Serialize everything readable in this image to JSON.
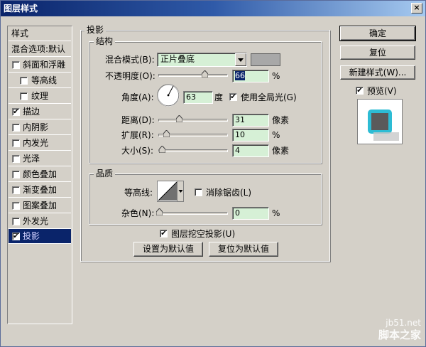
{
  "window": {
    "title": "图层样式",
    "close_glyph": "×"
  },
  "style_list": {
    "header": "样式",
    "blend_row": "混合选项:默认",
    "items": [
      {
        "label": "斜面和浮雕",
        "checked": false,
        "check_glyph": ""
      },
      {
        "label": "等高线",
        "checked": false,
        "check_glyph": ""
      },
      {
        "label": "纹理",
        "checked": false,
        "check_glyph": ""
      },
      {
        "label": "描边",
        "checked": true,
        "check_glyph": "✔"
      },
      {
        "label": "内阴影",
        "checked": false,
        "check_glyph": ""
      },
      {
        "label": "内发光",
        "checked": false,
        "check_glyph": ""
      },
      {
        "label": "光泽",
        "checked": false,
        "check_glyph": ""
      },
      {
        "label": "颜色叠加",
        "checked": false,
        "check_glyph": ""
      },
      {
        "label": "渐变叠加",
        "checked": false,
        "check_glyph": ""
      },
      {
        "label": "图案叠加",
        "checked": false,
        "check_glyph": ""
      },
      {
        "label": "外发光",
        "checked": false,
        "check_glyph": ""
      },
      {
        "label": "投影",
        "checked": true,
        "check_glyph": "✔"
      }
    ]
  },
  "drop_shadow": {
    "title": "投影",
    "structure": {
      "title": "结构",
      "blend_mode_label": "混合模式(B):",
      "blend_mode_value": "正片叠底",
      "opacity_label": "不透明度(O):",
      "opacity_value": "66",
      "opacity_unit": "%",
      "angle_label": "角度(A):",
      "angle_value": "63",
      "angle_unit": "度",
      "global_light_label": "使用全局光(G)",
      "global_light_checked": true,
      "global_light_glyph": "✔",
      "distance_label": "距离(D):",
      "distance_value": "31",
      "distance_unit": "像素",
      "spread_label": "扩展(R):",
      "spread_value": "10",
      "spread_unit": "%",
      "size_label": "大小(S):",
      "size_value": "4",
      "size_unit": "像素"
    },
    "quality": {
      "title": "品质",
      "contour_label": "等高线:",
      "antialias_label": "消除锯齿(L)",
      "antialias_checked": false,
      "noise_label": "杂色(N):",
      "noise_value": "0",
      "noise_unit": "%"
    },
    "knockout_label": "图层挖空投影(U)",
    "knockout_checked": true,
    "knockout_glyph": "✔",
    "set_default_label": "设置为默认值",
    "reset_default_label": "复位为默认值"
  },
  "buttons": {
    "ok": "确定",
    "reset": "复位",
    "new_style": "新建样式(W)...",
    "preview_label": "预览(V)",
    "preview_glyph": "✔"
  },
  "watermark": {
    "line1": "jb51.net",
    "line2": "脚本之家"
  }
}
